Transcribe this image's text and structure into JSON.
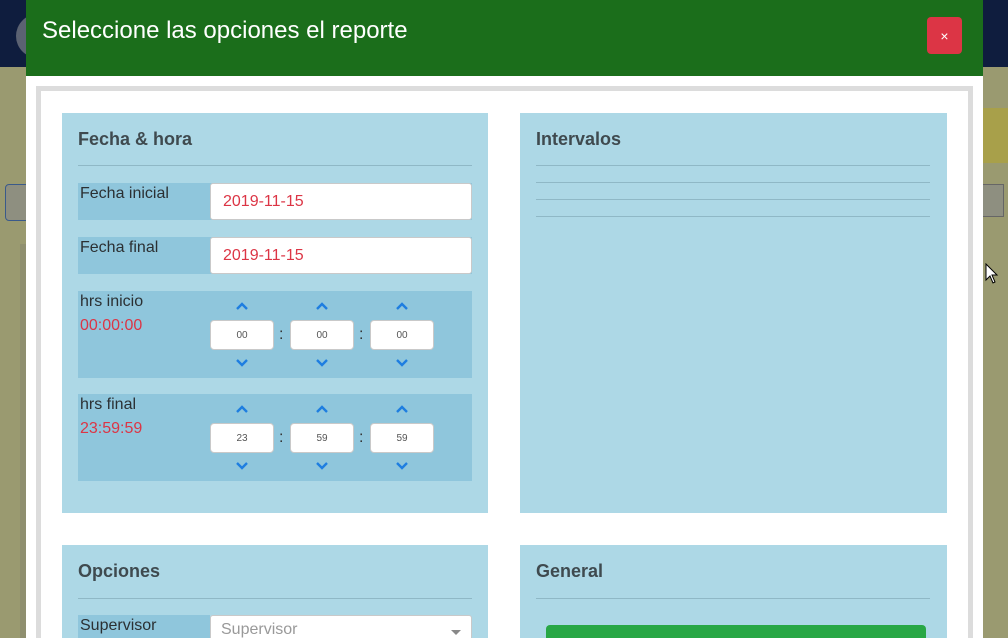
{
  "modal": {
    "title": "Seleccione las opciones el reporte",
    "close_label": "×"
  },
  "fecha_panel": {
    "title": "Fecha & hora",
    "fecha_inicial_label": "Fecha inicial",
    "fecha_inicial_value": "2019-11-15",
    "fecha_final_label": "Fecha final",
    "fecha_final_value": "2019-11-15",
    "hrs_inicio_label": "hrs inicio",
    "hrs_inicio_value": "00:00:00",
    "hrs_inicio_h": "00",
    "hrs_inicio_m": "00",
    "hrs_inicio_s": "00",
    "hrs_final_label": "hrs final",
    "hrs_final_value": "23:59:59",
    "hrs_final_h": "23",
    "hrs_final_m": "59",
    "hrs_final_s": "59",
    "separator": ":"
  },
  "intervalos_panel": {
    "title": "Intervalos"
  },
  "opciones_panel": {
    "title": "Opciones",
    "supervisor_label": "Supervisor",
    "supervisor_placeholder": "Supervisor"
  },
  "general_panel": {
    "title": "General"
  },
  "colors": {
    "header": "#1b6e1b",
    "panel": "#add8e6",
    "row": "#8fc6dc",
    "accent_red": "#dc3545",
    "chevron_blue": "#1e7ee0",
    "button_green": "#28a745"
  },
  "icons": [
    "close-icon",
    "chevron-up-icon",
    "chevron-down-icon",
    "dropdown-caret-icon",
    "mouse-pointer-icon"
  ]
}
